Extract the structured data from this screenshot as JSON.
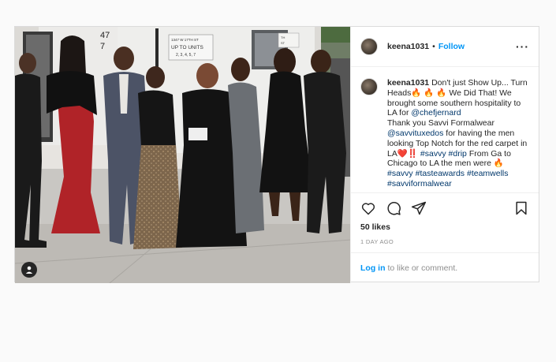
{
  "post": {
    "username": "keena1031",
    "follow_label": "Follow",
    "more_icon": "more-options-icon",
    "photo_sign": {
      "number": "47",
      "line1": "1347 W 17TH ST",
      "line2": "UP TO UNITS",
      "line3": "2, 3, 4, 5, 7",
      "sign_small": "TH",
      "sign_mid": "ST"
    },
    "caption": {
      "username": "keena1031",
      "seg1": "Don't just Show Up... Turn Heads",
      "emoji_fire": "🔥",
      "seg2": "We Did That! We brought some southern hospitality to LA for",
      "mention1": "@chefjernard",
      "seg3": "Thank you Savvi Formalwear",
      "mention2": "@savvituxedos",
      "seg4": "for having the men looking Top Notch for the red carpet in LA",
      "emoji_heart": "❤️",
      "emoji_bang": "‼️",
      "tag1": "#savvy",
      "tag2": "#drip",
      "seg5": "From Ga to Chicago to LA the men were",
      "tag3": "#savvy",
      "tag4": "#tasteawards",
      "tag5": "#teamwells",
      "tag6": "#savviformalwear"
    },
    "likes": "50 likes",
    "timestamp": "1 DAY AGO",
    "login_link": "Log in",
    "login_rest": "to like or comment."
  },
  "colors": {
    "link_blue": "#0095f6",
    "mention_blue": "#00376b",
    "border": "#dbdbdb",
    "muted": "#8e8e8e"
  }
}
